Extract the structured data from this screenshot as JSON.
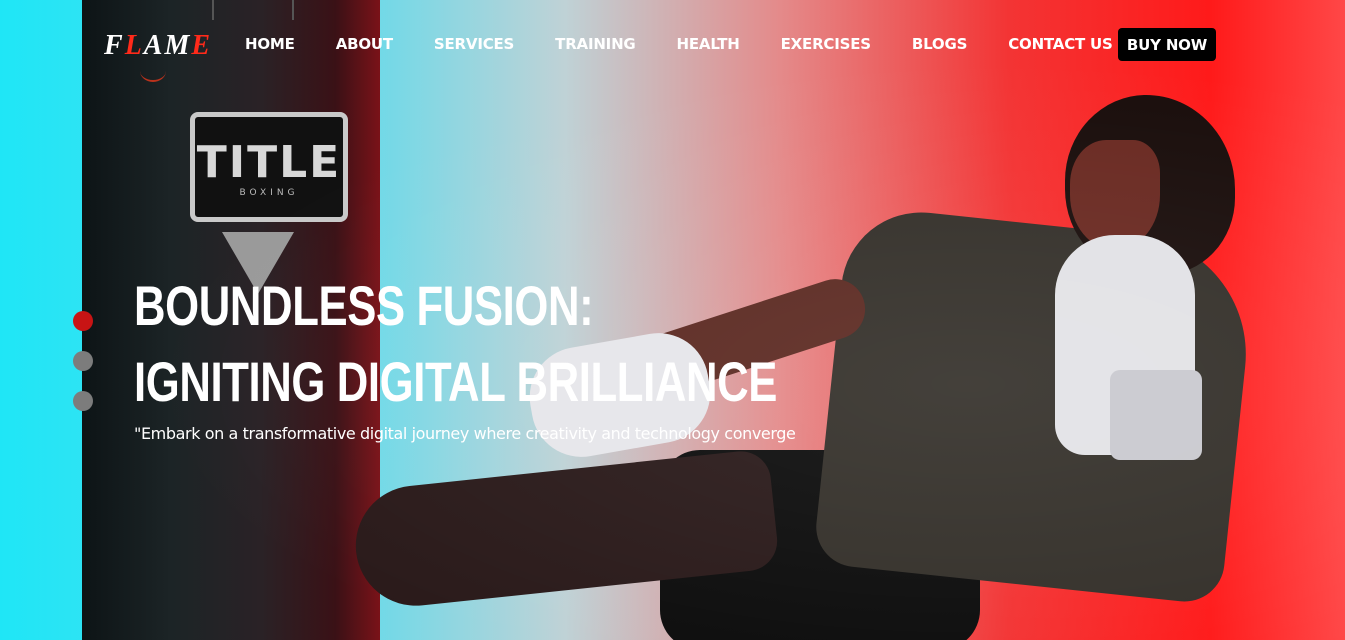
{
  "brand": {
    "logo_text_pre": "F",
    "logo_text_accent": "L",
    "logo_text_mid": "AM",
    "logo_text_end": "E",
    "accent_color": "#ff2a1a"
  },
  "nav": {
    "items": [
      {
        "label": "HOME"
      },
      {
        "label": "ABOUT"
      },
      {
        "label": "SERVICES"
      },
      {
        "label": "TRAINING"
      },
      {
        "label": "HEALTH"
      },
      {
        "label": "EXERCISES"
      },
      {
        "label": "BLOGS"
      },
      {
        "label": "CONTACT US"
      }
    ],
    "cta_label": "BUY NOW"
  },
  "hero": {
    "headline_line1": "BOUNDLESS FUSION:",
    "headline_line2": "IGNITING DIGITAL BRILLIANCE",
    "tagline": "\"Embark on a transformative digital journey where creativity and technology converge",
    "bag_brand": "TITLE",
    "bag_brand_sub": "BOXING",
    "slides": {
      "count": 3,
      "active_index": 0
    },
    "colors": {
      "left": "#1fe6f6",
      "right": "#ff1a1a",
      "dot_active": "#c81414",
      "dot_inactive": "#7c7c7c"
    }
  }
}
